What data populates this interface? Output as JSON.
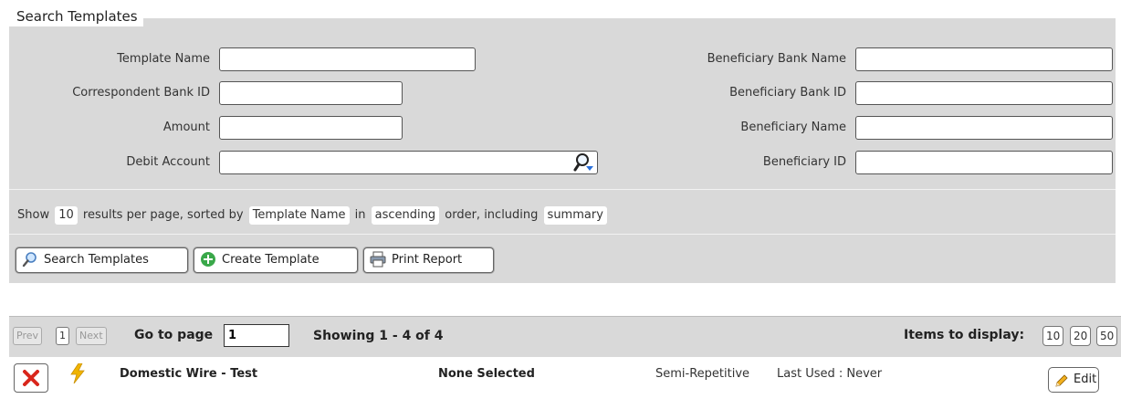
{
  "search": {
    "legend": "Search Templates",
    "fields_left": [
      {
        "label": "Template Name",
        "value": ""
      },
      {
        "label": "Correspondent Bank ID",
        "value": ""
      },
      {
        "label": "Amount",
        "value": ""
      },
      {
        "label": "Debit Account",
        "value": ""
      }
    ],
    "fields_right": [
      {
        "label": "Beneficiary Bank Name",
        "value": ""
      },
      {
        "label": "Beneficiary Bank ID",
        "value": ""
      },
      {
        "label": "Beneficiary Name",
        "value": ""
      },
      {
        "label": "Beneficiary ID",
        "value": ""
      }
    ],
    "options": {
      "show": "Show",
      "per_page": "10",
      "text_results": "results per page, sorted by",
      "sort_field": "Template Name",
      "text_in": "in",
      "sort_order": "ascending",
      "text_order": "order, including",
      "detail": "summary"
    },
    "buttons": {
      "search": "Search Templates",
      "create": "Create Template",
      "print": "Print Report"
    }
  },
  "results": {
    "prev": "Prev",
    "page": "1",
    "next": "Next",
    "goto_label": "Go to page",
    "goto_value": "1",
    "showing": "Showing 1 - 4 of 4",
    "items_label": "Items to display:",
    "items_options": [
      "10",
      "20",
      "50"
    ]
  },
  "rows": [
    {
      "name": "Domestic Wire - Test",
      "account": "None Selected",
      "type": "Semi-Repetitive",
      "last_used": "Last Used : Never",
      "edit": "Edit"
    }
  ],
  "colors": {
    "panel_bg": "#d9d9d9",
    "delete_red": "#d9261c",
    "flash_yellow": "#f0b400"
  }
}
